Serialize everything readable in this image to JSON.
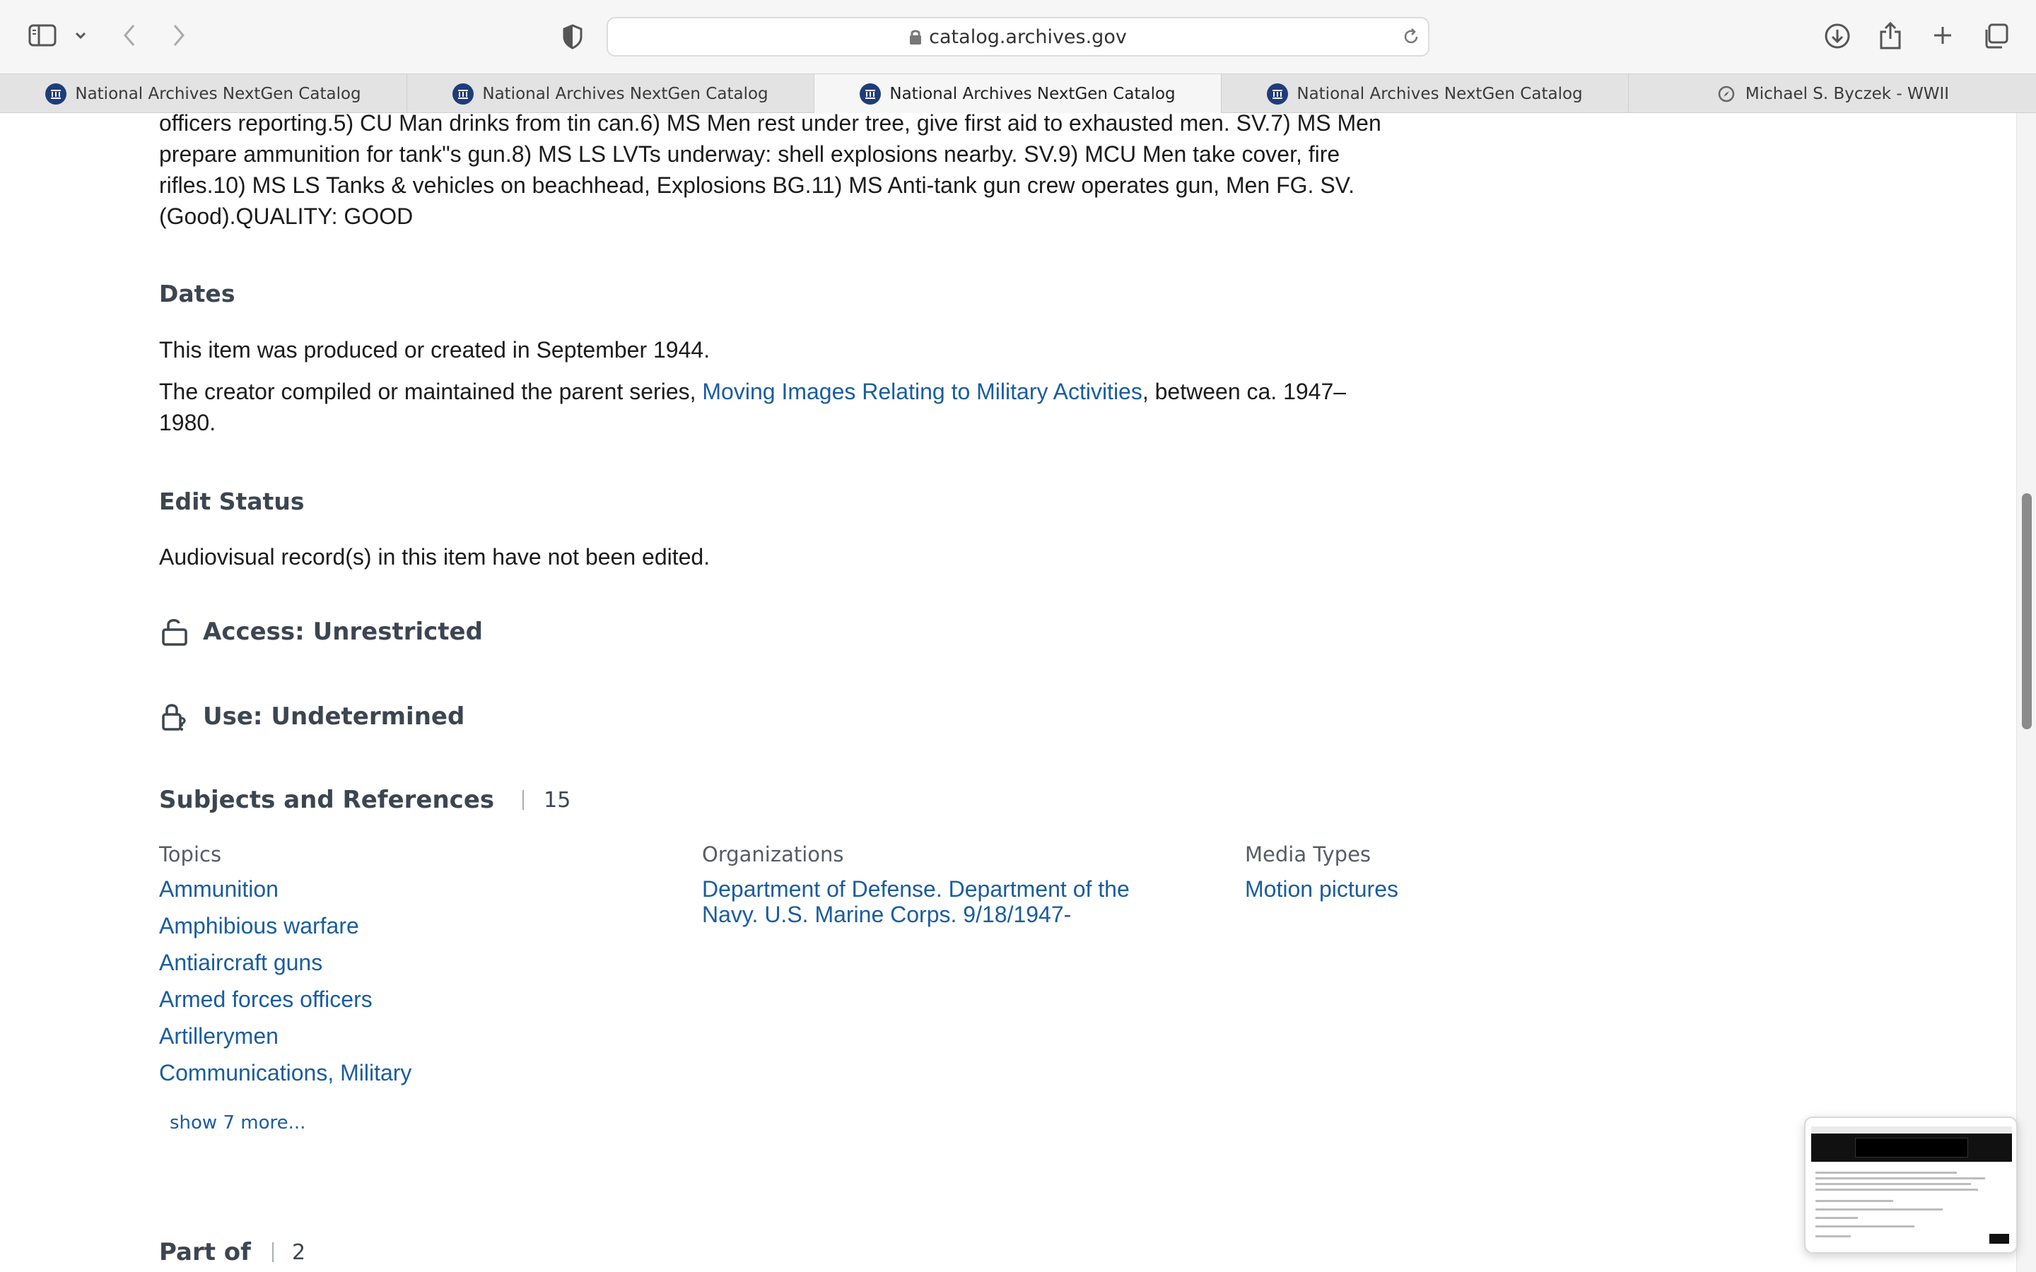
{
  "browser": {
    "url": "catalog.archives.gov",
    "tabs": [
      {
        "label": "National Archives NextGen Catalog",
        "icon": "archives-icon",
        "active": false
      },
      {
        "label": "National Archives NextGen Catalog",
        "icon": "archives-icon",
        "active": false
      },
      {
        "label": "National Archives NextGen Catalog",
        "icon": "archives-icon",
        "active": true
      },
      {
        "label": "National Archives NextGen Catalog",
        "icon": "archives-icon",
        "active": false
      },
      {
        "label": "Michael S. Byczek - WWII",
        "icon": "compass-icon",
        "active": false
      }
    ]
  },
  "description": {
    "lines": [
      "officers reporting.5) CU Man drinks from tin can.6) MS Men rest under tree, give first aid to exhausted men. SV.7) MS Men",
      "prepare ammunition for tank\"s gun.8) MS LS LVTs underway: shell explosions nearby. SV.9) MCU Men take cover, fire",
      "rifles.10) MS LS Tanks & vehicles on beachhead, Explosions BG.11) MS Anti-tank gun crew operates gun, Men FG. SV.",
      "(Good).QUALITY: GOOD"
    ]
  },
  "dates": {
    "heading": "Dates",
    "produced": "This item was produced or created in September 1944.",
    "parent_prefix": "The creator compiled or maintained the parent series, ",
    "parent_link": "Moving Images Relating to Military Activities",
    "parent_suffix": ", between ca. 1947–",
    "parent_suffix2": "1980."
  },
  "edit_status": {
    "heading": "Edit Status",
    "text": "Audiovisual record(s) in this item have not been edited."
  },
  "access": {
    "label": "Access: Unrestricted",
    "icon": "unlocked-icon"
  },
  "use": {
    "label": "Use: Undetermined",
    "icon": "use-lock-icon"
  },
  "subjects": {
    "heading": "Subjects and References",
    "count": "15",
    "topics_label": "Topics",
    "topics": [
      "Ammunition",
      "Amphibious warfare",
      "Antiaircraft guns",
      "Armed forces officers",
      "Artillerymen",
      "Communications, Military"
    ],
    "organizations_label": "Organizations",
    "organizations_line1": "Department of Defense. Department of the",
    "organizations_line2": "Navy. U.S. Marine Corps. 9/18/1947-",
    "media_label": "Media Types",
    "media": [
      "Motion pictures"
    ],
    "show_more": "show 7 more..."
  },
  "part_of": {
    "heading": "Part of",
    "count": "2"
  },
  "colors": {
    "link": "#1a5c9f",
    "heading": "#3d4551",
    "tab_icon": "#1f3c7a"
  }
}
